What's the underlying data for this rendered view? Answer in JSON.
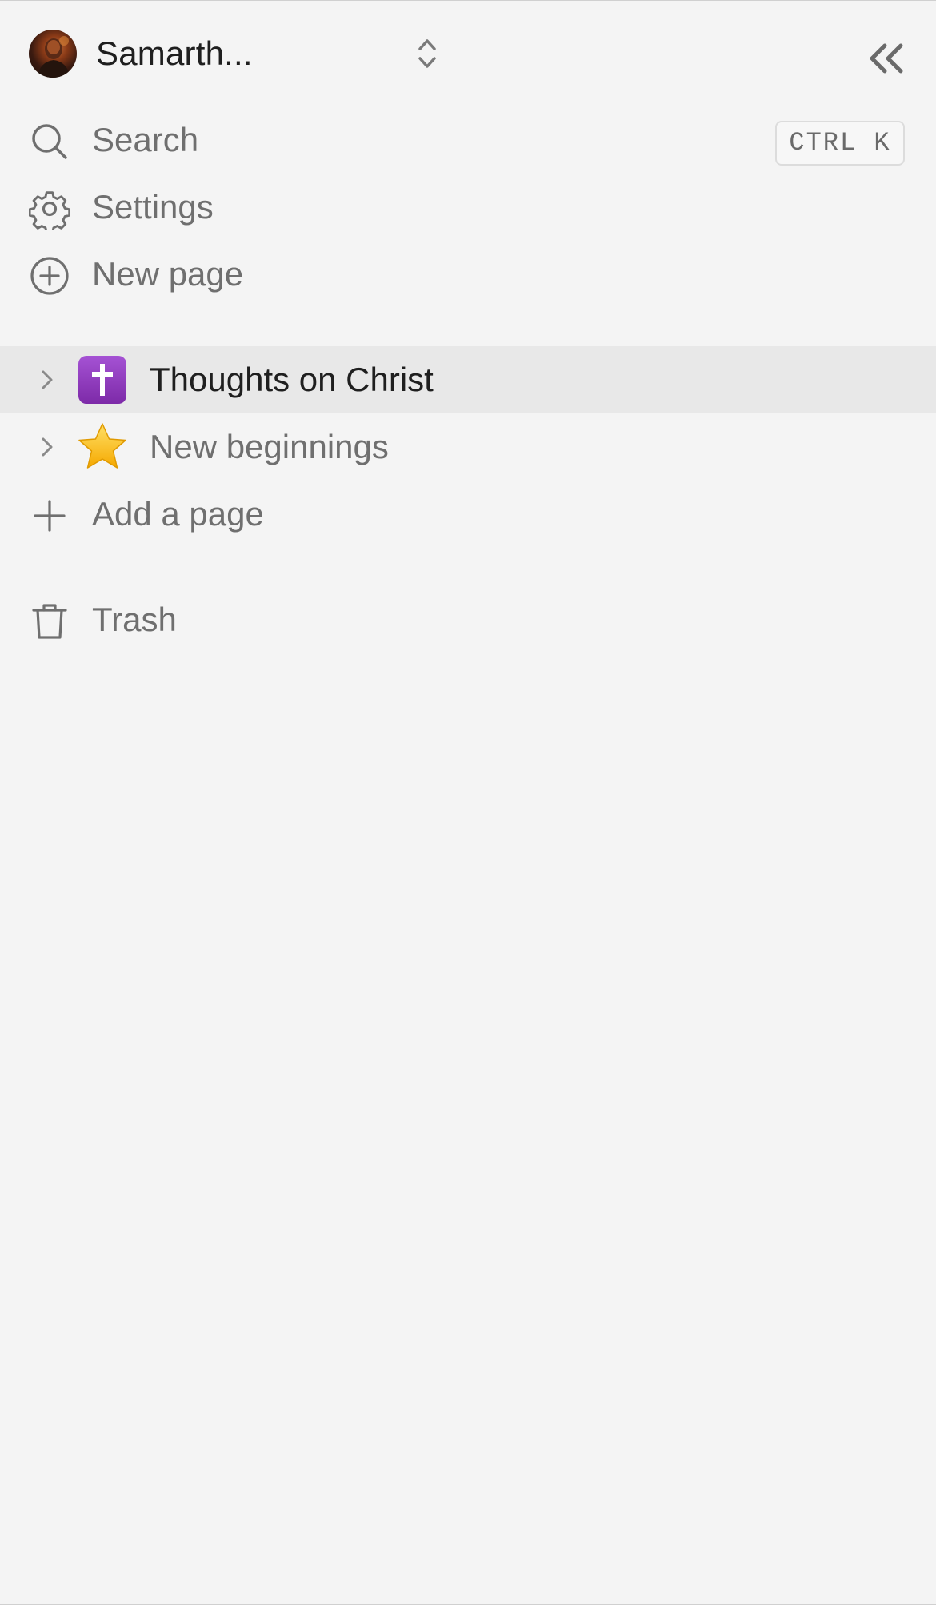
{
  "header": {
    "workspace_name": "Samarth...",
    "switcher_icon": "chevron-up-down-icon",
    "collapse_icon": "double-chevron-left-icon"
  },
  "menu": {
    "search": {
      "label": "Search",
      "shortcut": "CTRL K",
      "icon": "search-icon"
    },
    "settings": {
      "label": "Settings",
      "icon": "gear-icon"
    },
    "new_page": {
      "label": "New page",
      "icon": "plus-circle-icon"
    }
  },
  "pages": [
    {
      "label": "Thoughts on Christ",
      "emoji": "latin-cross-emoji",
      "selected": true
    },
    {
      "label": "New beginnings",
      "emoji": "star-emoji",
      "selected": false
    }
  ],
  "add_page": {
    "label": "Add a page",
    "icon": "plus-icon"
  },
  "trash": {
    "label": "Trash",
    "icon": "trash-icon"
  },
  "colors": {
    "background": "#f4f4f4",
    "selected_row": "#e8e8e8",
    "text_primary": "#1f1f1f",
    "text_secondary": "#6f6f6f",
    "cross_emoji_purple": "#8e36b8",
    "star_emoji_yellow": "#ffc21a"
  }
}
